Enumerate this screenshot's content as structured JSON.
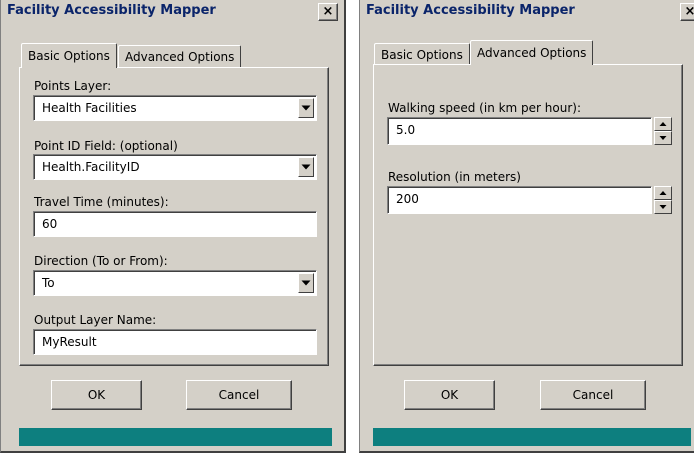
{
  "colors": {
    "title_text": "#0a246a",
    "dialog_bg": "#d4d0c8",
    "status_bar": "#0d7f7f"
  },
  "left_dialog": {
    "title": "Facility Accessibility Mapper",
    "close_glyph": "×",
    "tabs": [
      "Basic Options",
      "Advanced Options"
    ],
    "active_tab": "Basic Options",
    "fields": {
      "points_layer_label": "Points Layer:",
      "points_layer_value": "Health Facilities",
      "point_id_label": "Point ID Field: (optional)",
      "point_id_value": "Health.FacilityID",
      "travel_time_label": "Travel Time (minutes):",
      "travel_time_value": "60",
      "direction_label": "Direction (To or From):",
      "direction_value": "To",
      "output_label": "Output Layer Name:",
      "output_value": "MyResult"
    },
    "buttons": {
      "ok": "OK",
      "cancel": "Cancel"
    }
  },
  "right_dialog": {
    "title": "Facility Accessibility Mapper",
    "close_glyph": "×",
    "tabs": [
      "Basic Options",
      "Advanced Options"
    ],
    "active_tab": "Advanced Options",
    "fields": {
      "walking_speed_label": "Walking speed (in km per hour):",
      "walking_speed_value": "5.0",
      "resolution_label": "Resolution (in meters)",
      "resolution_value": "200"
    },
    "buttons": {
      "ok": "OK",
      "cancel": "Cancel"
    }
  }
}
